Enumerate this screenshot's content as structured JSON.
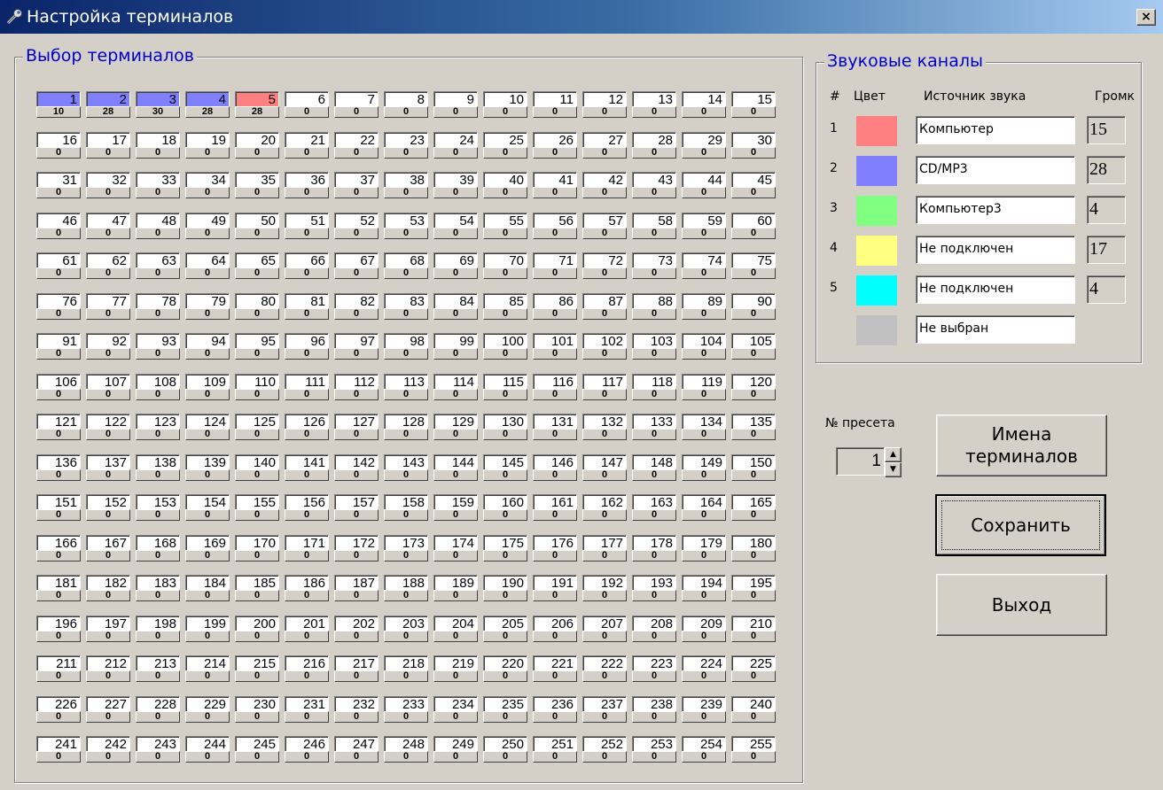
{
  "window": {
    "title": "Настройка терминалов",
    "close_label": "×"
  },
  "terminals_group": {
    "title": "Выбор терминалов"
  },
  "terminals": [
    {
      "num": "1",
      "vol": "10",
      "color": "#8080ff"
    },
    {
      "num": "2",
      "vol": "28",
      "color": "#8080ff"
    },
    {
      "num": "3",
      "vol": "30",
      "color": "#8080ff"
    },
    {
      "num": "4",
      "vol": "28",
      "color": "#8080ff"
    },
    {
      "num": "5",
      "vol": "28",
      "color": "#ff8080"
    }
  ],
  "terminals_default": {
    "vol": "0",
    "color": "#ffffff",
    "count": 255
  },
  "channels_group": {
    "title": "Звуковые каналы",
    "headers": {
      "num": "#",
      "color": "Цвет",
      "source": "Источник звука",
      "volume": "Громк"
    }
  },
  "channels": [
    {
      "num": "1",
      "color": "#ff8080",
      "source": "Компьютер",
      "volume": "15"
    },
    {
      "num": "2",
      "color": "#8080ff",
      "source": "CD/MP3",
      "volume": "28"
    },
    {
      "num": "3",
      "color": "#80ff80",
      "source": "Компьютер3",
      "volume": "4"
    },
    {
      "num": "4",
      "color": "#ffff80",
      "source": "Не подключен",
      "volume": "17"
    },
    {
      "num": "5",
      "color": "#00ffff",
      "source": "Не подключен",
      "volume": "4"
    },
    {
      "num": "",
      "color": "#c0c0c0",
      "source": "Не выбран",
      "volume": ""
    }
  ],
  "preset": {
    "label": "№ пресета",
    "value": "1",
    "up_icon": "▲",
    "down_icon": "▼"
  },
  "buttons": {
    "names": "Имена терминалов",
    "save": "Сохранить",
    "exit": "Выход"
  }
}
